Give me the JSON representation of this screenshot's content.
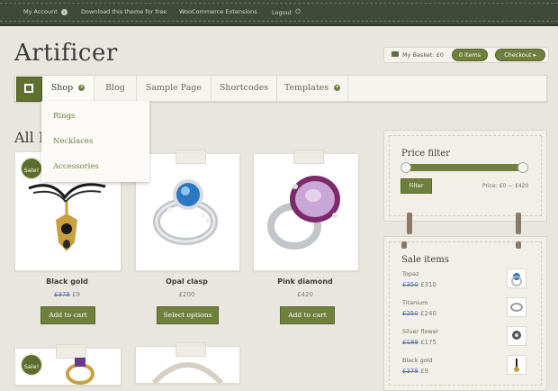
{
  "topbar": {
    "items": [
      {
        "label": "My Account",
        "icon": "circle-arrow-icon"
      },
      {
        "label": "Download this theme for free"
      },
      {
        "label": "WooCommerce Extensions"
      },
      {
        "label": "Logout",
        "icon": "logout-icon"
      }
    ]
  },
  "logo": "Artificer",
  "basket": {
    "label": "My Basket: £0",
    "items": "0 items",
    "checkout": "Checkout ▸"
  },
  "nav": {
    "tabs": [
      {
        "label": "Shop",
        "has_dropdown": true
      },
      {
        "label": "Blog"
      },
      {
        "label": "Sample Page"
      },
      {
        "label": "Shortcodes"
      },
      {
        "label": "Templates",
        "has_dropdown": true
      }
    ],
    "dropdown": [
      "Rings",
      "Necklaces",
      "Accessories"
    ]
  },
  "heading": "All I",
  "products": [
    {
      "name": "Black gold",
      "old_price": "£378",
      "price": "£9",
      "sale": true,
      "button": "Add to cart"
    },
    {
      "name": "Opal clasp",
      "price": "£200",
      "sale": false,
      "button": "Select options"
    },
    {
      "name": "Pink diamond",
      "price": "£420",
      "sale": false,
      "button": "Add to cart"
    }
  ],
  "bottom_products": [
    {
      "sale": true
    },
    {
      "sale": false
    }
  ],
  "sale_badge": "Sale!",
  "price_filter": {
    "title": "Price filter",
    "button": "Filter",
    "range": "Price: £0 — £420"
  },
  "sale_items": {
    "title": "Sale items",
    "items": [
      {
        "name": "Topaz",
        "old_price": "£350",
        "price": "£310"
      },
      {
        "name": "Titanium",
        "old_price": "£250",
        "price": "£240"
      },
      {
        "name": "Silver flower",
        "old_price": "£189",
        "price": "£175"
      },
      {
        "name": "Black gold",
        "old_price": "£378",
        "price": "£9"
      }
    ]
  },
  "colors": {
    "accent": "#6f7f3c",
    "topbar": "#3f4a37",
    "background": "#e9e6e0"
  }
}
